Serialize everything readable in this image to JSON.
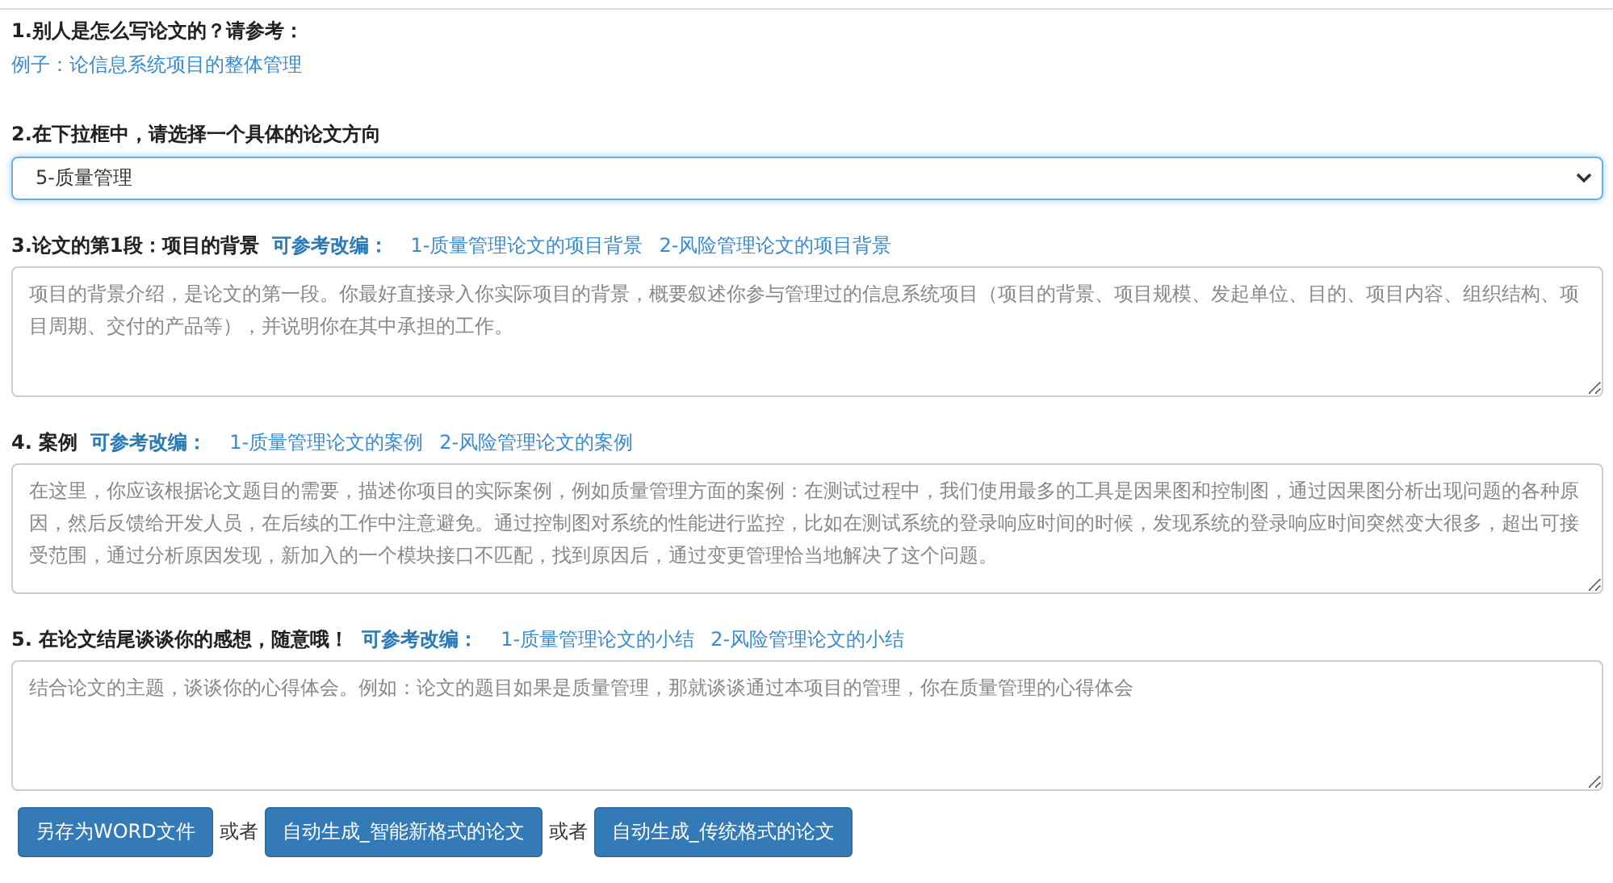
{
  "intro": {
    "heading": "1.别人是怎么写论文的？请参考：",
    "example_link": "例子：论信息系统项目的整体管理"
  },
  "direction": {
    "heading": "2.在下拉框中，请选择一个具体的论文方向",
    "value": "5-质量管理"
  },
  "sections": [
    {
      "heading": "3.论文的第1段：项目的背景",
      "hint": "可参考改编：",
      "links": [
        "1-质量管理论文的项目背景",
        "2-风险管理论文的项目背景"
      ],
      "placeholder": "项目的背景介绍，是论文的第一段。你最好直接录入你实际项目的背景，概要叙述你参与管理过的信息系统项目（项目的背景、项目规模、发起单位、目的、项目内容、组织结构、项目周期、交付的产品等），并说明你在其中承担的工作。"
    },
    {
      "heading": "4. 案例",
      "hint": "可参考改编：",
      "links": [
        "1-质量管理论文的案例",
        "2-风险管理论文的案例"
      ],
      "placeholder": "在这里，你应该根据论文题目的需要，描述你项目的实际案例，例如质量管理方面的案例：在测试过程中，我们使用最多的工具是因果图和控制图，通过因果图分析出现问题的各种原因，然后反馈给开发人员，在后续的工作中注意避免。通过控制图对系统的性能进行监控，比如在测试系统的登录响应时间的时候，发现系统的登录响应时间突然变大很多，超出可接受范围，通过分析原因发现，新加入的一个模块接口不匹配，找到原因后，通过变更管理恰当地解决了这个问题。"
    },
    {
      "heading": "5. 在论文结尾谈谈你的感想，随意哦！",
      "hint": "可参考改编：",
      "links": [
        "1-质量管理论文的小结",
        "2-风险管理论文的小结"
      ],
      "placeholder": "结合论文的主题，谈谈你的心得体会。例如：论文的题目如果是质量管理，那就谈谈通过本项目的管理，你在质量管理的心得体会"
    }
  ],
  "actions": [
    {
      "kind": "button",
      "label": "另存为WORD文件"
    },
    {
      "kind": "text",
      "label": "或者"
    },
    {
      "kind": "button",
      "label": "自动生成_智能新格式的论文"
    },
    {
      "kind": "text",
      "label": "或者"
    },
    {
      "kind": "button",
      "label": "自动生成_传统格式的论文"
    }
  ]
}
